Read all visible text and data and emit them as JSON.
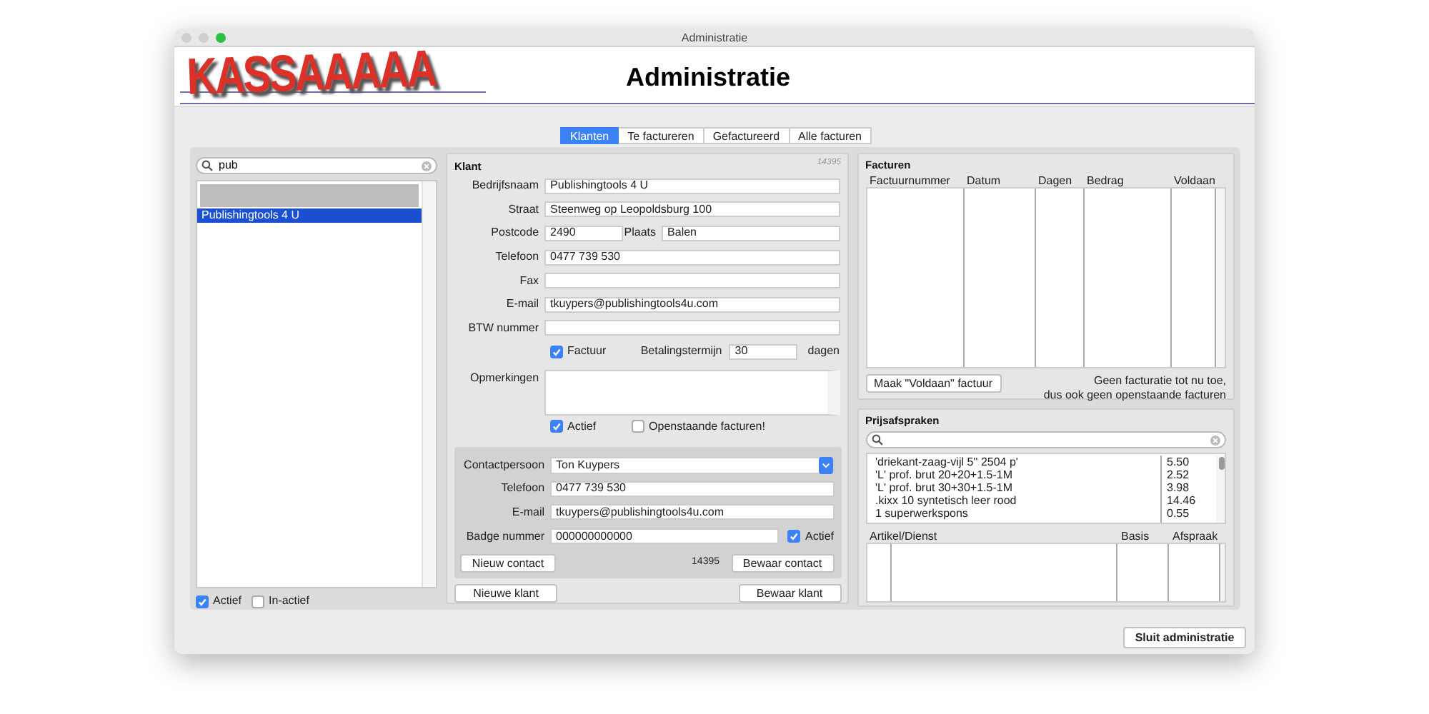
{
  "window": {
    "title": "Administratie"
  },
  "header": {
    "logo": "KASSAAAAA",
    "title": "Administratie"
  },
  "tabs": [
    {
      "label": "Klanten",
      "selected": true
    },
    {
      "label": "Te factureren",
      "selected": false
    },
    {
      "label": "Gefactureerd",
      "selected": false
    },
    {
      "label": "Alle facturen",
      "selected": false
    }
  ],
  "search": {
    "value": "pub"
  },
  "customers": [
    {
      "name": "Publishingtools 4 U",
      "selected": true
    }
  ],
  "filters": [
    {
      "label": "Actief",
      "checked": true
    },
    {
      "label": "In-actief",
      "checked": false
    }
  ],
  "klant": {
    "title": "Klant",
    "number": "14395",
    "fields": [
      {
        "kind": "text",
        "label": "Bedrijfsnaam",
        "value": "Publishingtools 4 U"
      },
      {
        "kind": "text",
        "label": "Straat",
        "value": "Steenweg op Leopoldsburg 100"
      },
      {
        "kind": "split",
        "label": "Postcode",
        "value": "2490",
        "label2": "Plaats",
        "value2": "Balen"
      },
      {
        "kind": "text",
        "label": "Telefoon",
        "value": "0477 739 530"
      },
      {
        "kind": "text",
        "label": "Fax"
      },
      {
        "kind": "text",
        "label": "E-mail",
        "value": "tkuypers@publishingtools4u.com"
      },
      {
        "kind": "text",
        "label": "BTW nummer"
      }
    ],
    "factuur": {
      "label": "Factuur",
      "checked": true,
      "term_label": "Betalingstermijn",
      "term_value": "30",
      "unit": "dagen"
    },
    "remarks_label": "Opmerkingen",
    "flags": [
      {
        "label": "Actief",
        "checked": true
      },
      {
        "label": "Openstaande facturen!",
        "checked": false
      }
    ]
  },
  "contact": {
    "person_label": "Contactpersoon",
    "person_value": "Ton Kuypers",
    "fields": [
      {
        "label": "Telefoon",
        "value": "0477 739 530"
      },
      {
        "label": "E-mail",
        "value": "tkuypers@publishingtools4u.com"
      }
    ],
    "badge_label": "Badge nummer",
    "badge_value": "000000000000",
    "active": {
      "label": "Actief",
      "checked": true
    },
    "new_button": "Nieuw contact",
    "number": "14395",
    "save_button": "Bewaar contact"
  },
  "klant_buttons": [
    "Nieuwe klant",
    "Bewaar klant"
  ],
  "facturen": {
    "title": "Facturen",
    "columns": [
      "Factuurnummer",
      "Datum",
      "Dagen",
      "Bedrag",
      "Voldaan"
    ],
    "button": "Maak \"Voldaan\" factuur",
    "message": [
      "Geen facturatie tot nu toe,",
      "dus ook geen openstaande facturen"
    ]
  },
  "prijsafspraken": {
    "title": "Prijsafspraken",
    "items": [
      {
        "name": "'driekant-zaag-vijl 5'' 2504 p'",
        "price": "5.50"
      },
      {
        "name": "'L' prof. brut 20+20+1.5-1M",
        "price": "2.52"
      },
      {
        "name": "'L' prof. brut 30+30+1.5-1M",
        "price": "3.98"
      },
      {
        "name": ".kixx 10 syntetisch leer rood",
        "price": "14.46"
      },
      {
        "name": "1 superwerkspons",
        "price": "0.55"
      }
    ],
    "columns": [
      "Artikel/Dienst",
      "Basis",
      "Afspraak"
    ]
  },
  "close_button": "Sluit administratie"
}
